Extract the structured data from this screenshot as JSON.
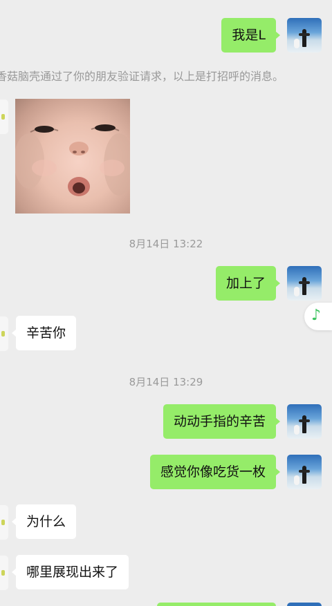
{
  "messages": {
    "m1": "我是L",
    "m2": "加上了",
    "m3": "辛苦你",
    "m4": "动动手指的辛苦",
    "m5": "感觉你像吃货一枚",
    "m6": "为什么",
    "m7": "哪里展现出来了"
  },
  "system_notice": "香菇脑壳通过了你的朋友验证请求，以上是打招呼的消息。",
  "timestamps": {
    "t1": "8月14日 13:22",
    "t2": "8月14日 13:29"
  },
  "icons": {
    "music": "music-note-icon"
  },
  "colors": {
    "background": "#ededed",
    "outgoing_bubble": "#95ec69",
    "incoming_bubble": "#ffffff",
    "accent_green": "#3cc35f"
  }
}
